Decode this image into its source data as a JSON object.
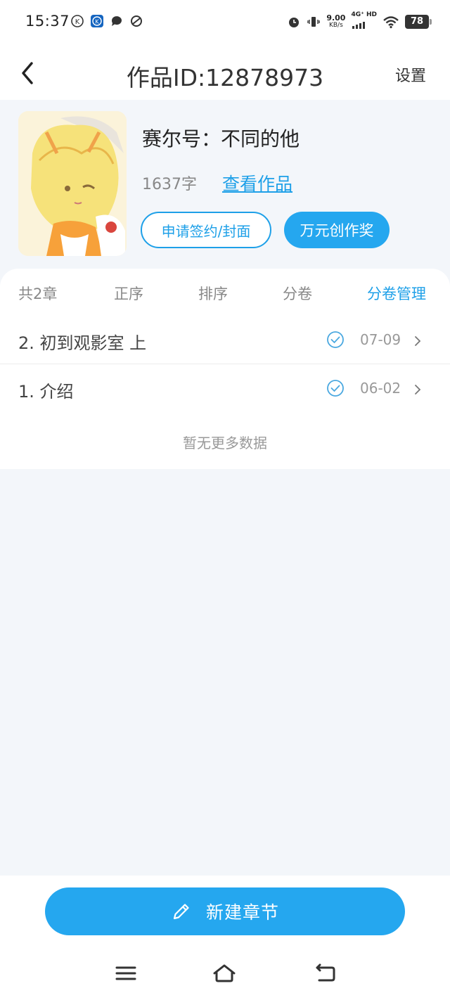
{
  "status_bar": {
    "time": "15:37",
    "net_speed_value": "9.00",
    "net_speed_unit": "KB/s",
    "net_type": "4G⁺ HD",
    "battery": "78"
  },
  "header": {
    "title": "作品ID:12878973",
    "settings_label": "设置"
  },
  "book": {
    "title": "赛尔号：不同的他",
    "word_count": "1637字",
    "view_link": "查看作品",
    "sign_button": "申请签约/封面",
    "award_button": "万元创作奖"
  },
  "toolbar": {
    "count": "共2章",
    "order": "正序",
    "sort": "排序",
    "volume": "分卷",
    "volume_manage": "分卷管理"
  },
  "chapters": [
    {
      "title": "2. 初到观影室  上",
      "date": "07-09"
    },
    {
      "title": "1. 介绍",
      "date": "06-02"
    }
  ],
  "no_more_text": "暂无更多数据",
  "new_chapter_button": "新建章节",
  "colors": {
    "accent": "#25a7ef",
    "link": "#1ea0e8",
    "background": "#f3f6fa"
  }
}
